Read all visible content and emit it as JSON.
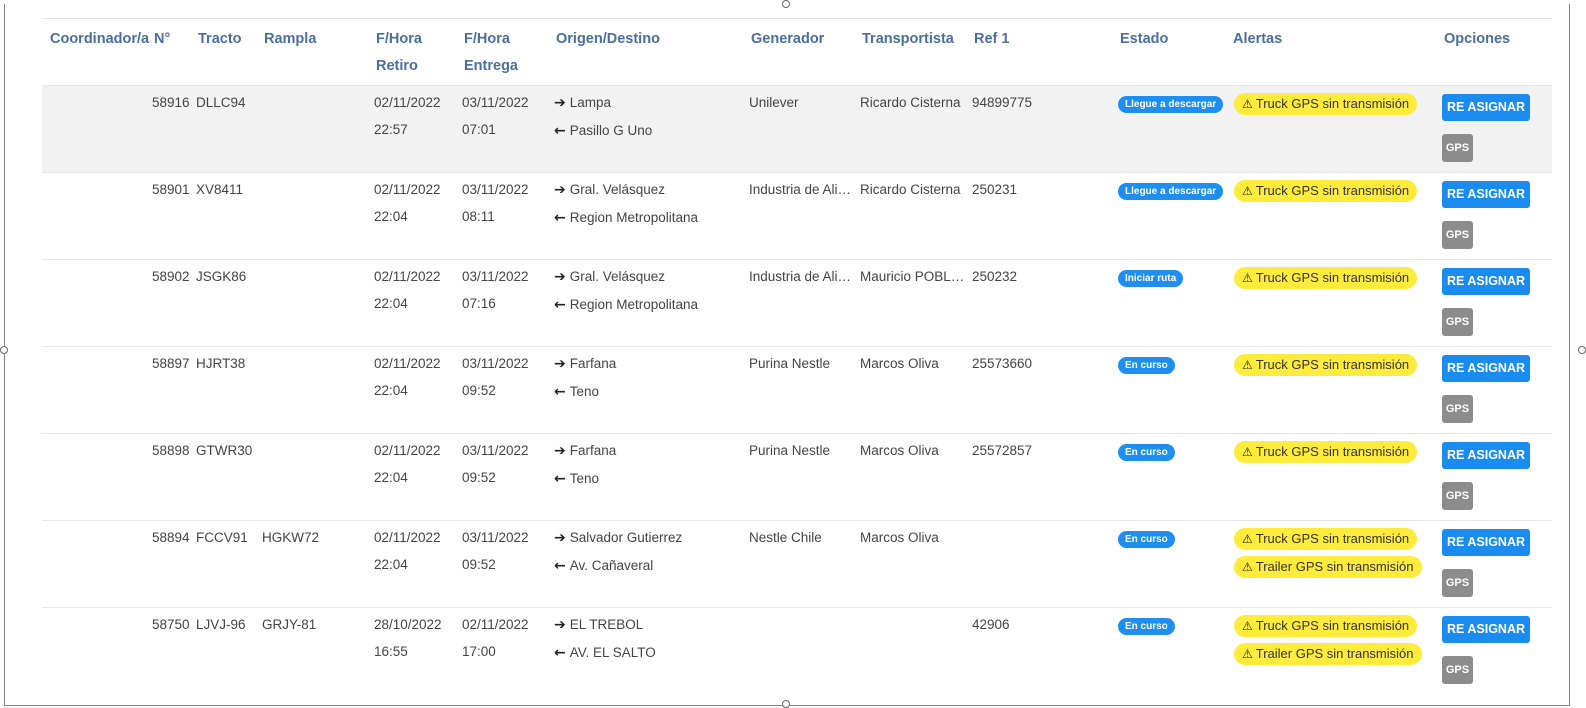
{
  "columns": [
    "Coordinador/a",
    "N°",
    "Tracto",
    "Rampla",
    "F/Hora Retiro",
    "F/Hora Entrega",
    "Origen/Destino",
    "Generador",
    "Transportista",
    "Ref 1",
    "Estado",
    "Alertas",
    "Opciones"
  ],
  "buttons": {
    "reasignar": "RE ASIGNAR",
    "gps": "GPS"
  },
  "rows": [
    {
      "coordinador": "",
      "numero": "58916",
      "tracto": "DLLC94",
      "rampla": "",
      "retiro_fecha": "02/11/2022",
      "retiro_hora": "22:57",
      "entrega_fecha": "03/11/2022",
      "entrega_hora": "07:01",
      "origen": "Lampa",
      "destino": "Pasillo G Uno",
      "generador": "Unilever",
      "transportista": "Ricardo Cisterna",
      "ref1": "94899775",
      "estado": "Llegue a descargar",
      "alertas": [
        "Truck GPS sin transmisión"
      ]
    },
    {
      "coordinador": "",
      "numero": "58901",
      "tracto": "XV8411",
      "rampla": "",
      "retiro_fecha": "02/11/2022",
      "retiro_hora": "22:04",
      "entrega_fecha": "03/11/2022",
      "entrega_hora": "08:11",
      "origen": "Gral. Velásquez",
      "destino": "Region Metropolitana",
      "generador": "Industria de Ali…",
      "transportista": "Ricardo Cisterna",
      "ref1": "250231",
      "estado": "Llegue a descargar",
      "alertas": [
        "Truck GPS sin transmisión"
      ]
    },
    {
      "coordinador": "",
      "numero": "58902",
      "tracto": "JSGK86",
      "rampla": "",
      "retiro_fecha": "02/11/2022",
      "retiro_hora": "22:04",
      "entrega_fecha": "03/11/2022",
      "entrega_hora": "07:16",
      "origen": "Gral. Velásquez",
      "destino": "Region Metropolitana",
      "generador": "Industria de Ali…",
      "transportista": "Mauricio POBLE…",
      "ref1": "250232",
      "estado": "Iniciar ruta",
      "alertas": [
        "Truck GPS sin transmisión"
      ]
    },
    {
      "coordinador": "",
      "numero": "58897",
      "tracto": "HJRT38",
      "rampla": "",
      "retiro_fecha": "02/11/2022",
      "retiro_hora": "22:04",
      "entrega_fecha": "03/11/2022",
      "entrega_hora": "09:52",
      "origen": "Farfana",
      "destino": "Teno",
      "generador": "Purina Nestle",
      "transportista": "Marcos Oliva",
      "ref1": "25573660",
      "estado": "En curso",
      "alertas": [
        "Truck GPS sin transmisión"
      ]
    },
    {
      "coordinador": "",
      "numero": "58898",
      "tracto": "GTWR30",
      "rampla": "",
      "retiro_fecha": "02/11/2022",
      "retiro_hora": "22:04",
      "entrega_fecha": "03/11/2022",
      "entrega_hora": "09:52",
      "origen": "Farfana",
      "destino": "Teno",
      "generador": "Purina Nestle",
      "transportista": "Marcos Oliva",
      "ref1": "25572857",
      "estado": "En curso",
      "alertas": [
        "Truck GPS sin transmisión"
      ]
    },
    {
      "coordinador": "",
      "numero": "58894",
      "tracto": "FCCV91",
      "rampla": "HGKW72",
      "retiro_fecha": "02/11/2022",
      "retiro_hora": "22:04",
      "entrega_fecha": "03/11/2022",
      "entrega_hora": "09:52",
      "origen": "Salvador Gutierrez",
      "destino": "Av. Cañaveral",
      "generador": "Nestle Chile",
      "transportista": "Marcos Oliva",
      "ref1": "",
      "estado": "En curso",
      "alertas": [
        "Truck GPS sin transmisión",
        "Trailer GPS sin transmisión"
      ]
    },
    {
      "coordinador": "",
      "numero": "58750",
      "tracto": "LJVJ-96",
      "rampla": "GRJY-81",
      "retiro_fecha": "28/10/2022",
      "retiro_hora": "16:55",
      "entrega_fecha": "02/11/2022",
      "entrega_hora": "17:00",
      "origen": "EL TREBOL",
      "destino": "AV. EL SALTO",
      "generador": "",
      "transportista": "",
      "ref1": "42906",
      "estado": "En curso",
      "alertas": [
        "Truck GPS sin transmisión",
        "Trailer GPS sin transmisión"
      ]
    }
  ],
  "colors": {
    "header_text": "#4a6e9e",
    "badge": "#1e8ef0",
    "alert": "#ffeb3b",
    "btn_primary": "#1a8cf0",
    "btn_gps": "#8c8c8c"
  },
  "icons": {
    "arrow_origen": "arrow-right-icon",
    "arrow_destino": "arrow-left-icon",
    "alert": "warning-triangle-icon"
  }
}
